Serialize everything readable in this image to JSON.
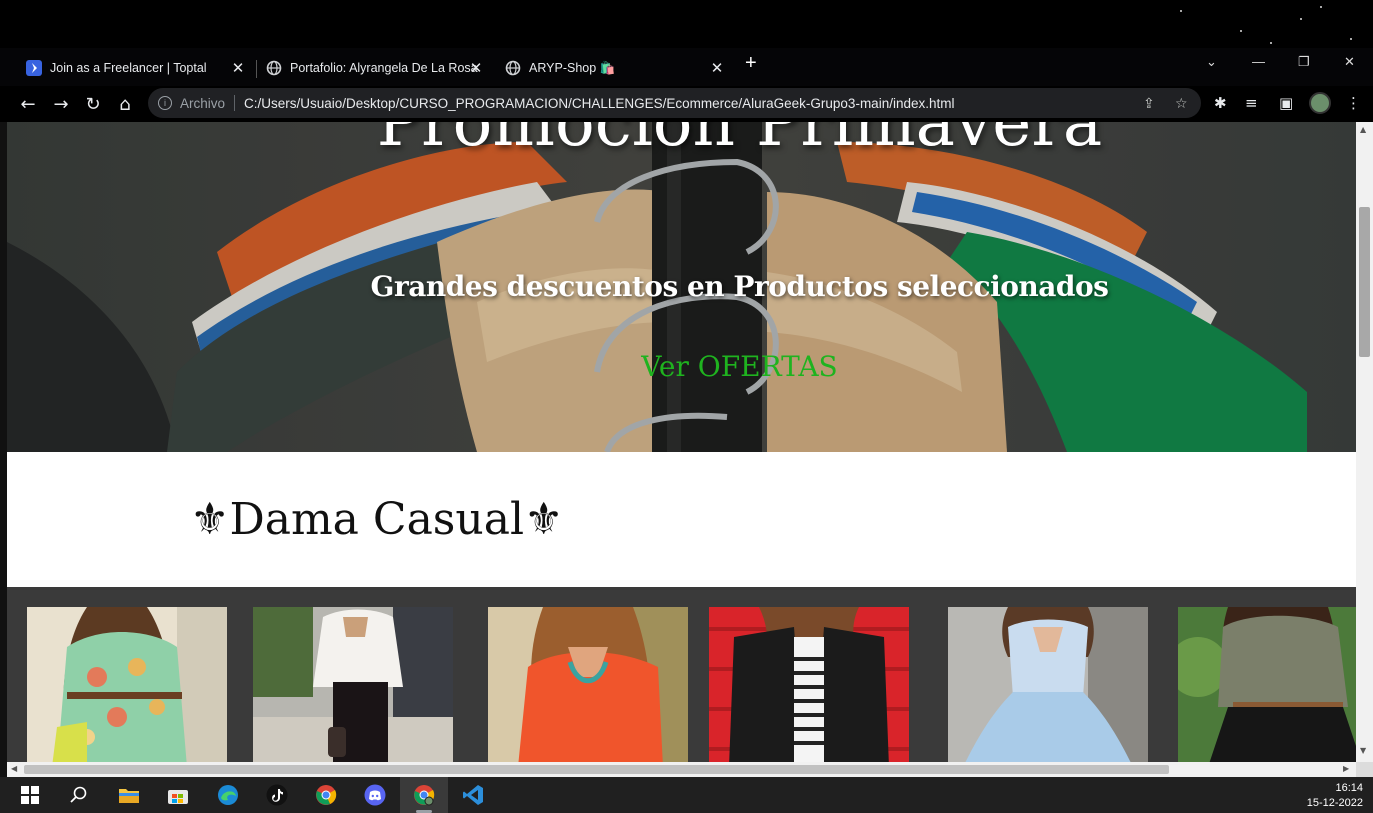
{
  "browser": {
    "tabs": [
      {
        "title": "Join as a Freelancer | Toptal",
        "icon": "toptal-icon",
        "active": false
      },
      {
        "title": "Portafolio: Alyrangela De La Rosa",
        "icon": "globe-icon",
        "active": false
      },
      {
        "title": "ARYP-Shop 🛍️",
        "icon": "globe-icon",
        "active": true
      }
    ],
    "new_tab_label": "+",
    "address": {
      "scheme_label": "Archivo",
      "url": "C:/Users/Usuaio/Desktop/CURSO_PROGRAMACION/CHALLENGES/Ecommerce/AluraGeek-Grupo3-main/index.html"
    }
  },
  "page": {
    "hero": {
      "title": "Promoción Primavera",
      "subtitle": "Grandes descuentos en Productos seleccionados",
      "cta": "Ver OFERTAS",
      "cta_color": "#1fb31f"
    },
    "section": {
      "title": "⚜Dama Casual⚜"
    },
    "products": [
      {
        "name": "floral-dress"
      },
      {
        "name": "white-blouse"
      },
      {
        "name": "orange-top"
      },
      {
        "name": "leather-jacket"
      },
      {
        "name": "blue-dress"
      },
      {
        "name": "olive-shirt"
      }
    ]
  },
  "taskbar": {
    "apps": [
      "start-icon",
      "search-icon",
      "file-explorer-icon",
      "store-icon",
      "edge-icon",
      "tiktok-icon",
      "chrome-icon",
      "discord-icon",
      "chrome-active-icon",
      "vscode-icon"
    ],
    "time": "16:14",
    "date": "15-12-2022"
  }
}
